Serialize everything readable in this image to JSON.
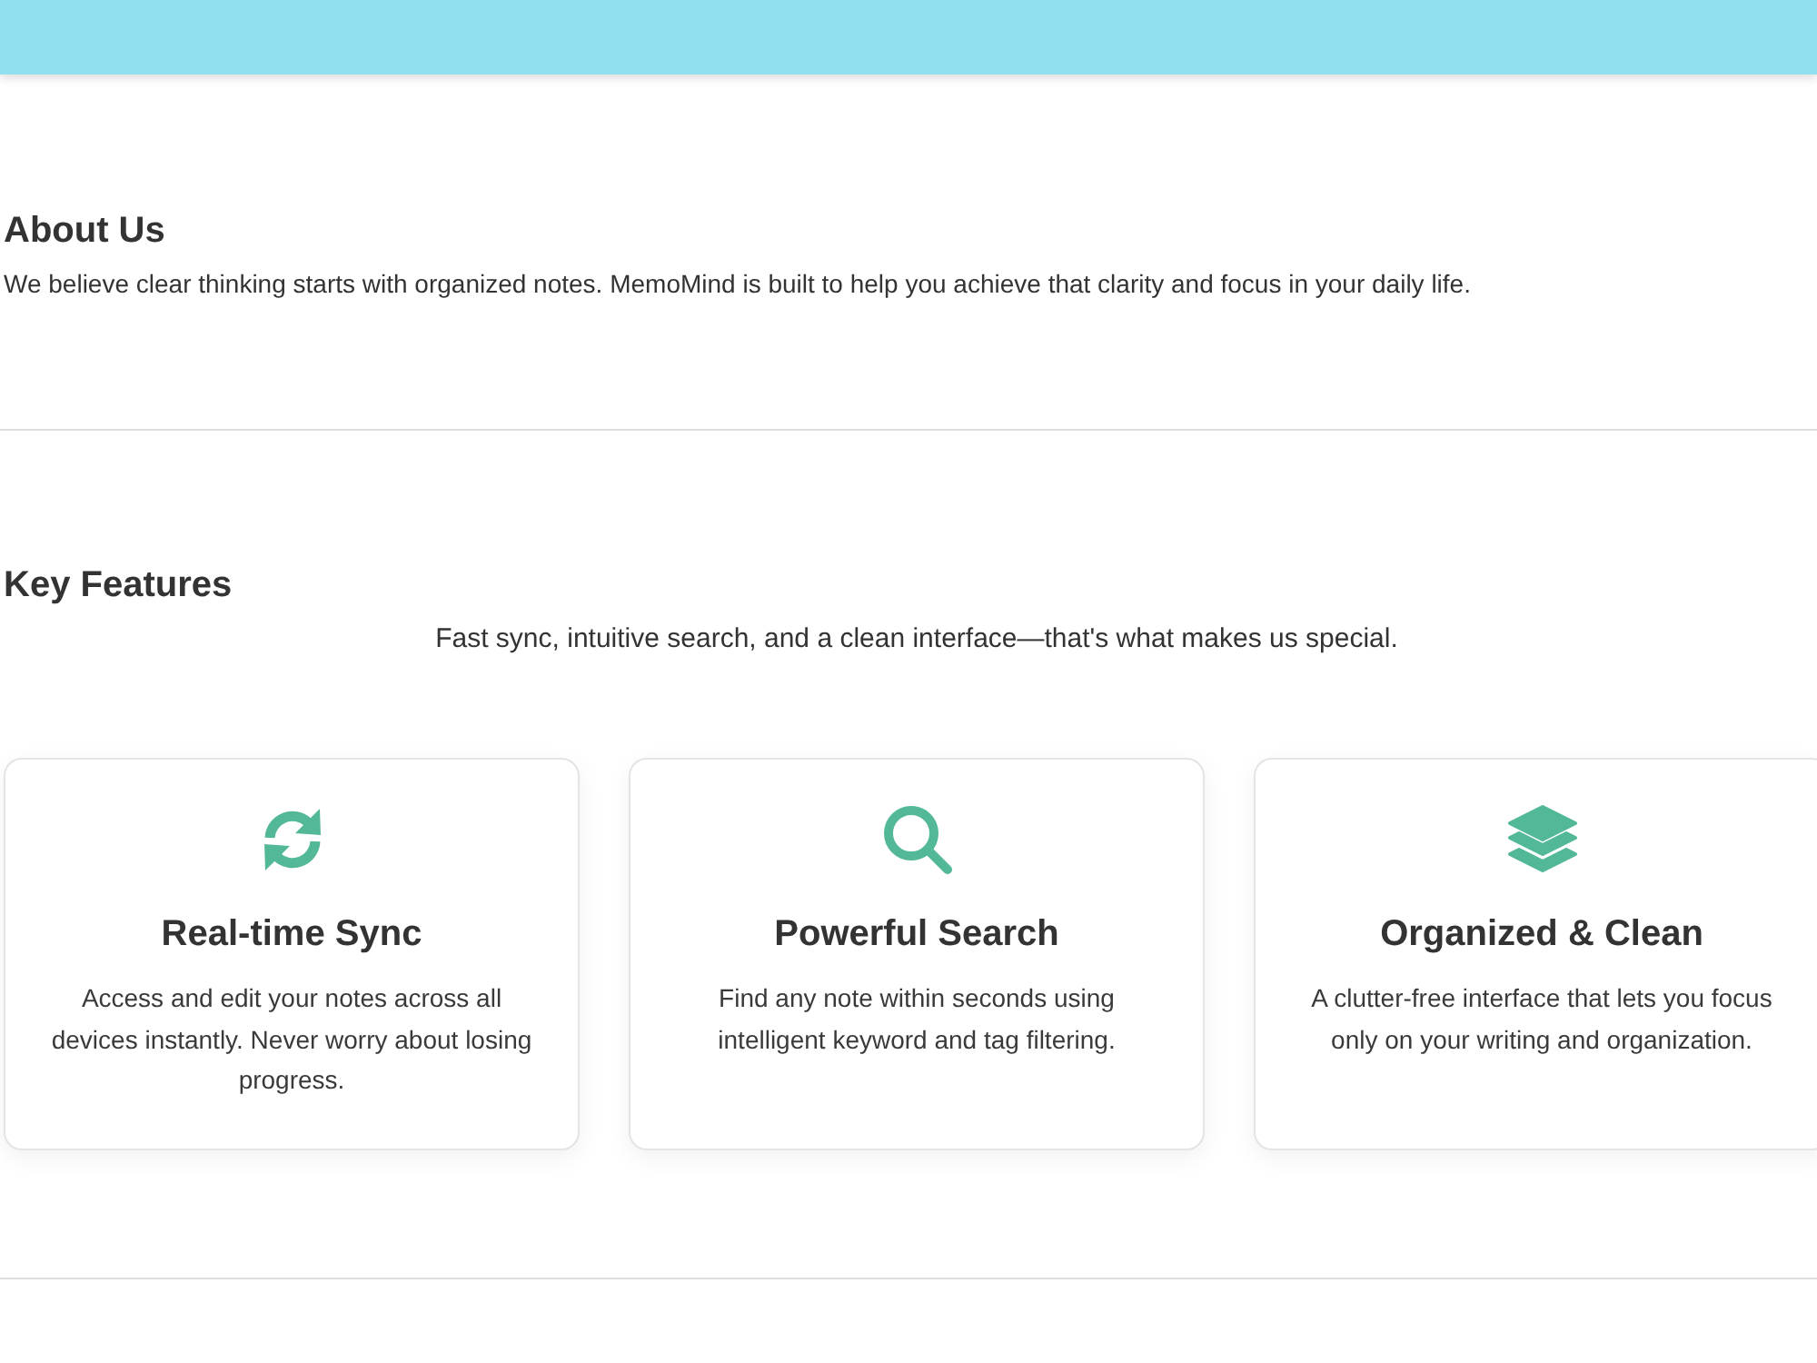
{
  "about": {
    "title": "About Us",
    "text": "We believe clear thinking starts with organized notes. MemoMind is built to help you achieve that clarity and focus in your daily life."
  },
  "features": {
    "title": "Key Features",
    "subtitle": "Fast sync, intuitive search, and a clean interface—that's what makes us special.",
    "items": [
      {
        "kind": "sync",
        "title": "Real-time Sync",
        "text": "Access and edit your notes across all devices instantly. Never worry about losing progress."
      },
      {
        "kind": "search",
        "title": "Powerful Search",
        "text": "Find any note within seconds using intelligent keyword and tag filtering."
      },
      {
        "kind": "layers",
        "title": "Organized & Clean",
        "text": "A clutter-free interface that lets you focus only on your writing and organization."
      }
    ]
  }
}
